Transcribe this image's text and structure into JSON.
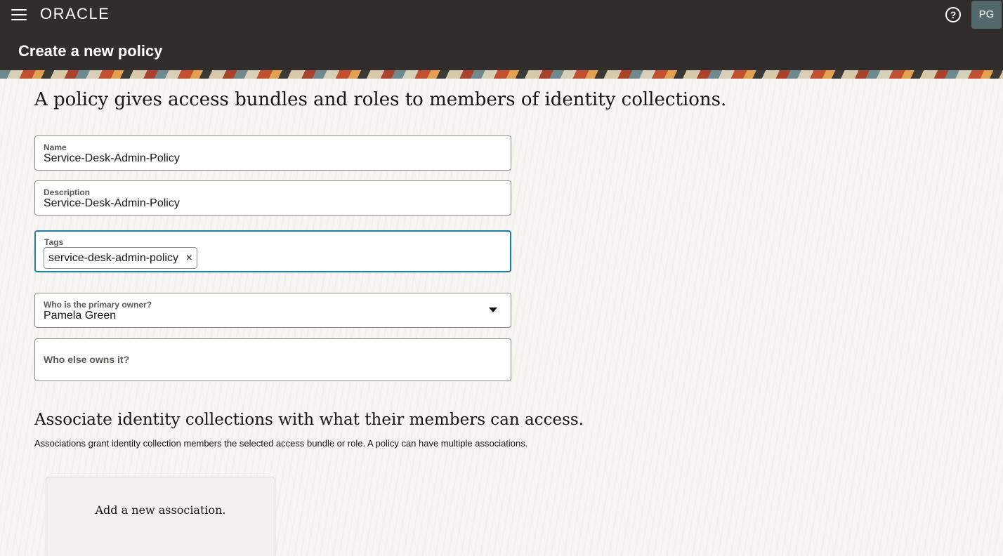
{
  "header": {
    "logo_text": "ORACLE",
    "help_icon": "?",
    "avatar_initials": "PG",
    "page_title": "Create a new policy"
  },
  "intro": {
    "heading": "A policy gives access bundles and roles to members of identity collections."
  },
  "form": {
    "name": {
      "label": "Name",
      "value": "Service-Desk-Admin-Policy"
    },
    "description": {
      "label": "Description",
      "value": "Service-Desk-Admin-Policy"
    },
    "tags": {
      "label": "Tags",
      "chips": [
        "service-desk-admin-policy"
      ],
      "remove_icon": "×"
    },
    "primary_owner": {
      "label": "Who is the primary owner?",
      "value": "Pamela Green"
    },
    "other_owners": {
      "label": "Who else owns it?"
    }
  },
  "associations": {
    "heading": "Associate identity collections with what their members can access.",
    "description": "Associations grant identity collection members the selected access bundle or role. A policy can have multiple associations.",
    "add_card_label": "Add a new association."
  },
  "colors": {
    "header_bg": "#312d2a",
    "avatar_bg": "#52696b",
    "focus_border": "#227e9e"
  },
  "icons": {
    "menu": "hamburger-menu-icon",
    "help": "help-circle-icon",
    "remove": "close-icon",
    "dropdown": "caret-down-icon"
  }
}
